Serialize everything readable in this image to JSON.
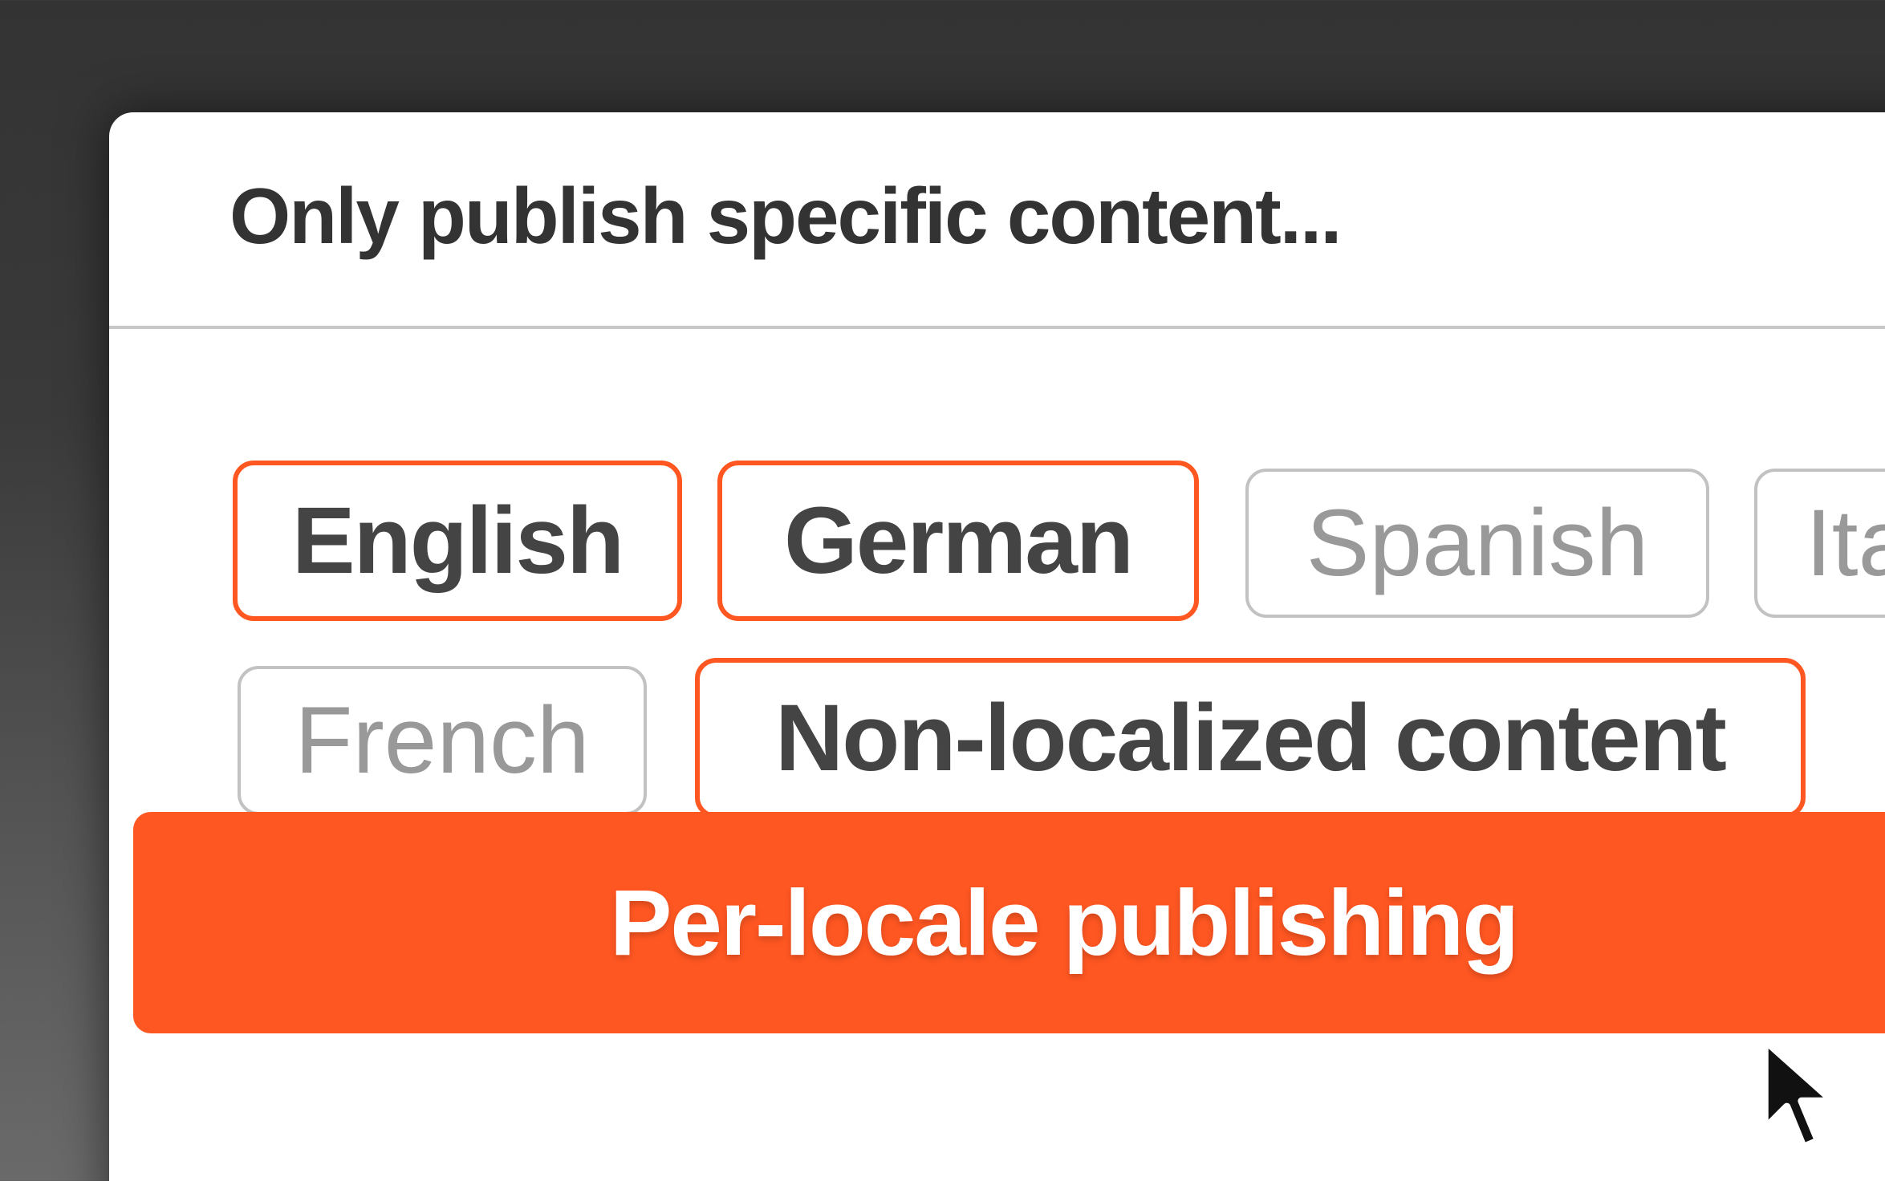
{
  "dialog": {
    "title": "Only publish specific content..."
  },
  "locales": [
    {
      "label": "English",
      "selected": true
    },
    {
      "label": "German",
      "selected": true
    },
    {
      "label": "Spanish",
      "selected": false
    },
    {
      "label": "Ita",
      "selected": false
    },
    {
      "label": "French",
      "selected": false
    },
    {
      "label": "Non-localized content",
      "selected": true
    }
  ],
  "actions": {
    "publish_label": "Per-locale publishing"
  },
  "colors": {
    "accent": "#ff5722",
    "text_dark": "#333333",
    "text_muted": "#999999",
    "border_muted": "#c2c2c2"
  },
  "icons": {
    "cursor": "mouse-pointer-icon"
  }
}
